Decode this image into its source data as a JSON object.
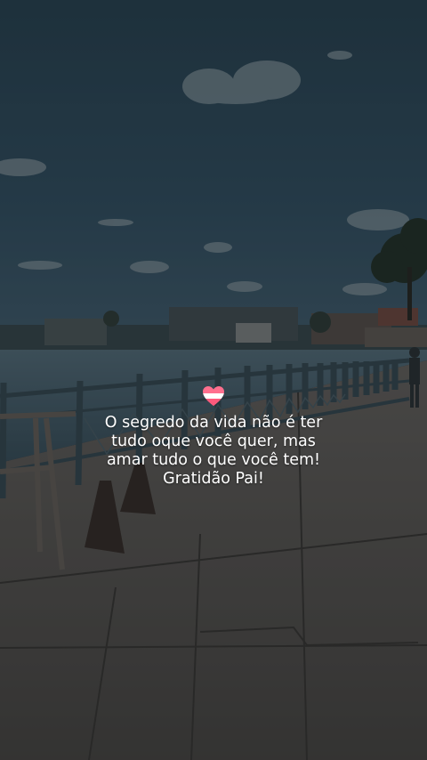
{
  "photo": {
    "subject": "lakeside promenade with metal railing under cloudy sky"
  },
  "caption": {
    "heart_icon": "heart-icon",
    "lines": [
      "O segredo da vida não é ter",
      "tudo oque você quer, mas",
      "amar tudo o que você tem!",
      "Gratidão Pai!"
    ]
  },
  "colors": {
    "text": "#ffffff",
    "heart_top": "#ff6f8e",
    "heart_band": "#ffffff"
  }
}
